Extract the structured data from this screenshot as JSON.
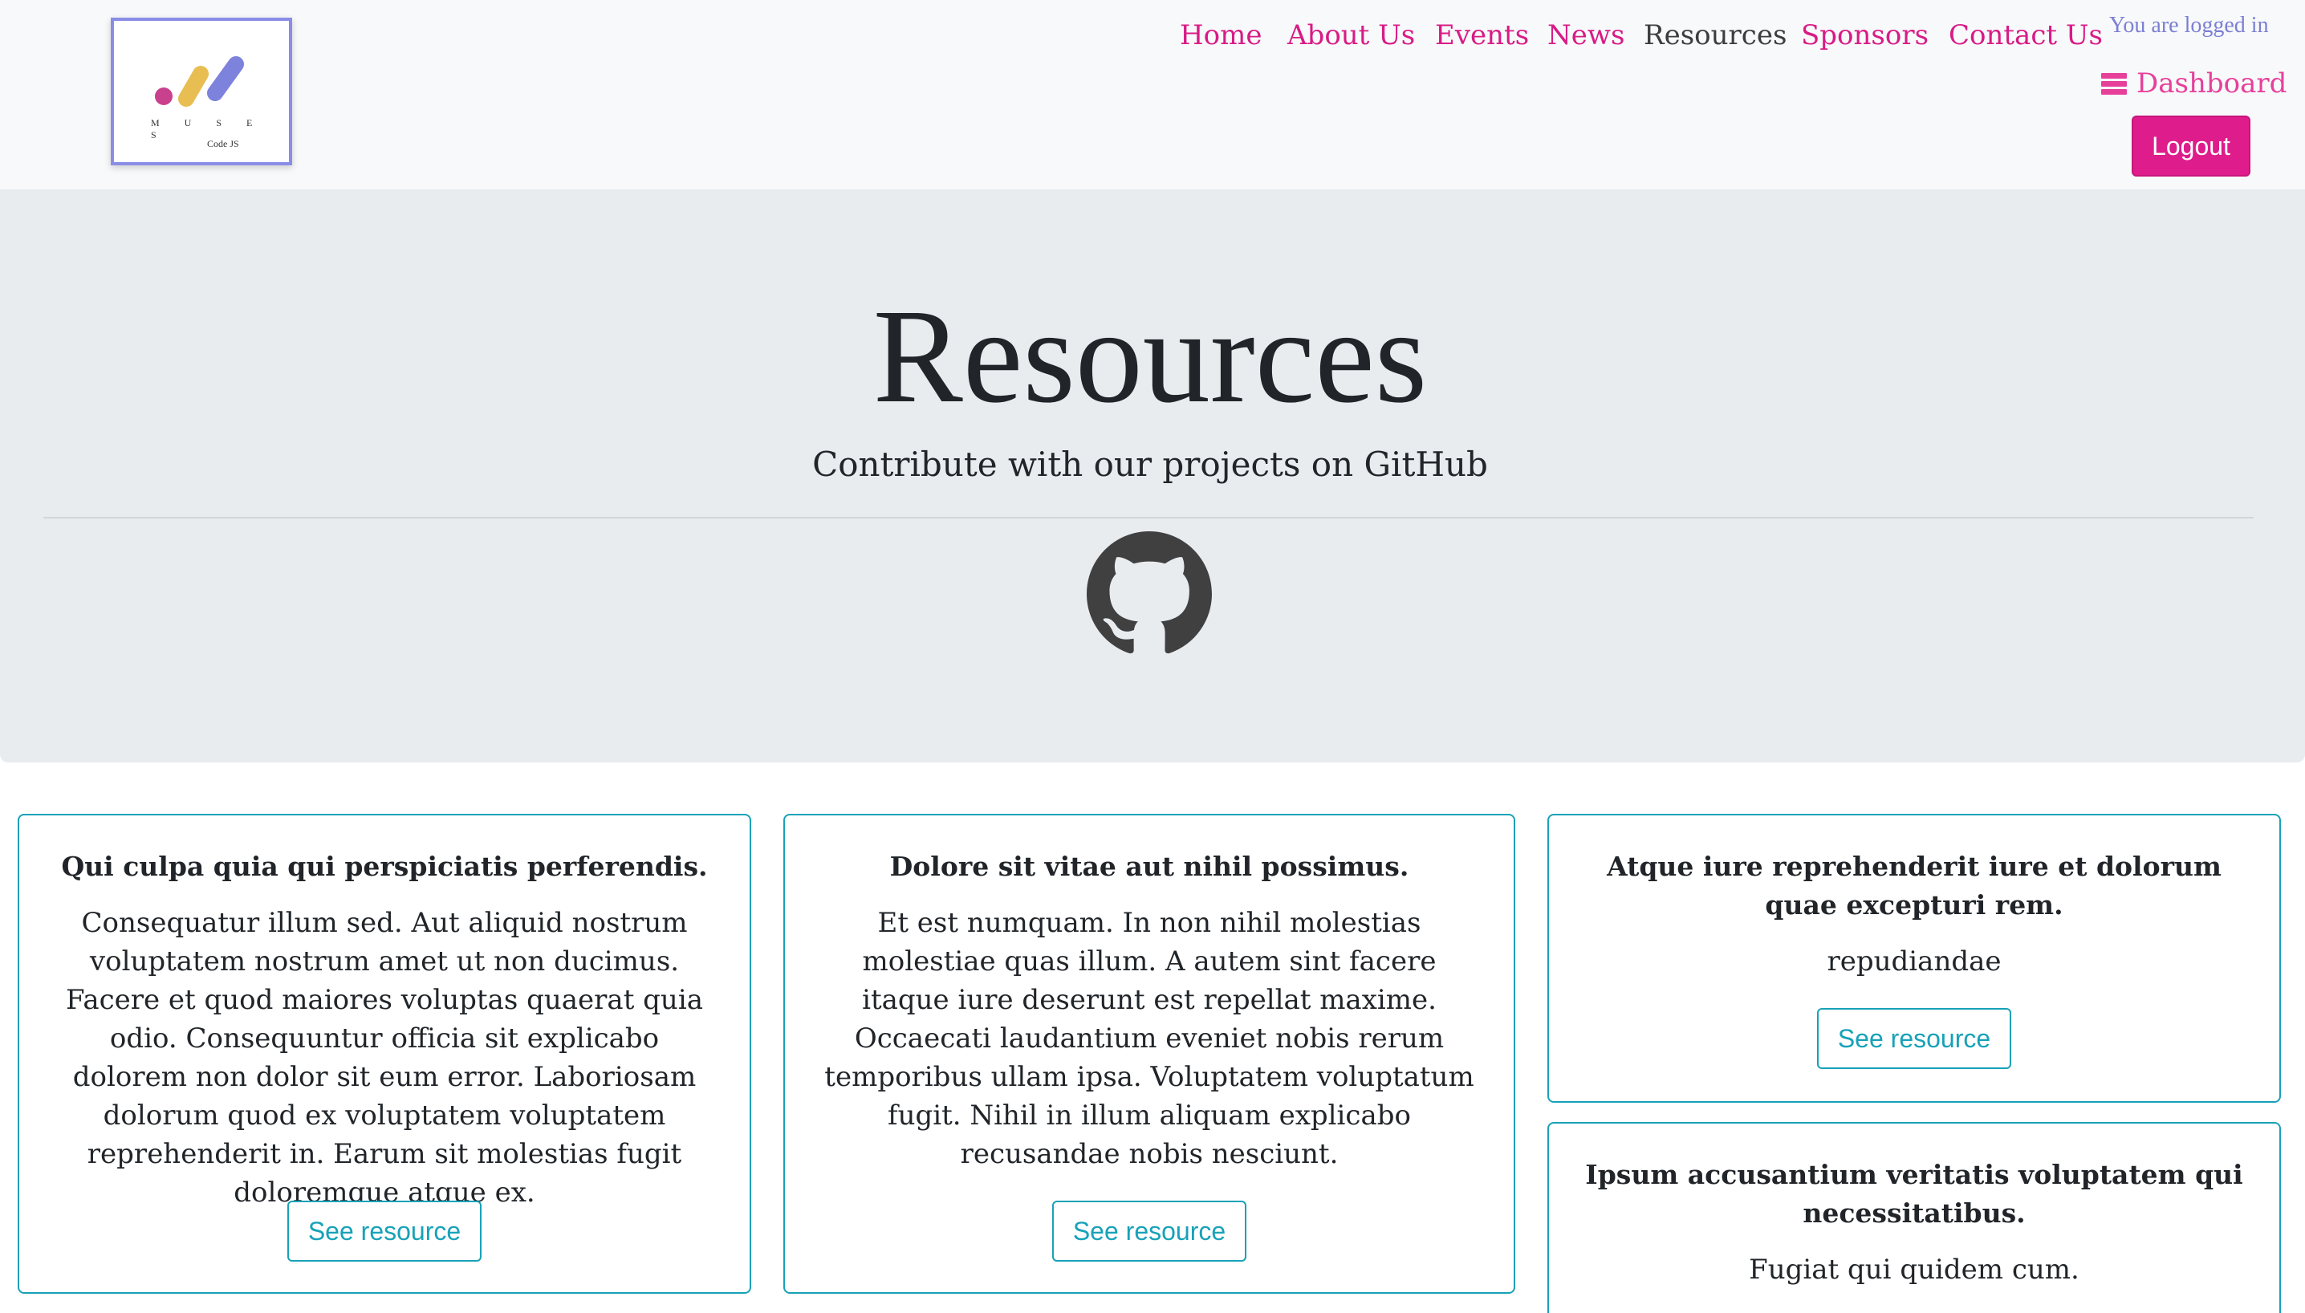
{
  "nav": {
    "logo": {
      "word": "M U S E S",
      "sub": "Code JS"
    },
    "links": [
      {
        "label": "Home",
        "active": false
      },
      {
        "label": "About Us",
        "active": false
      },
      {
        "label": "Events",
        "active": false
      },
      {
        "label": "News",
        "active": false
      },
      {
        "label": "Resources",
        "active": true
      },
      {
        "label": "Sponsors",
        "active": false
      },
      {
        "label": "Contact Us",
        "active": false
      }
    ],
    "logged_in_text": "You are logged in",
    "dashboard_label": "Dashboard",
    "logout_label": "Logout"
  },
  "hero": {
    "title": "Resources",
    "subtitle": "Contribute with our projects on GitHub",
    "icon": "github-icon"
  },
  "cards": [
    {
      "title": "Qui culpa quia qui perspiciatis perferendis.",
      "text": "Consequatur illum sed. Aut aliquid nostrum voluptatem nostrum amet ut non ducimus. Facere et quod maiores voluptas quaerat quia odio. Consequuntur officia sit explicabo dolorem non dolor sit eum error. Laboriosam dolorum quod ex voluptatem voluptatem reprehenderit in. Earum sit molestias fugit doloremque atque ex.",
      "button": "See resource"
    },
    {
      "title": "Dolore sit vitae aut nihil possimus.",
      "text": "Et est numquam. In non nihil molestias molestiae quas illum. A autem sint facere itaque iure deserunt est repellat maxime. Occaecati laudantium eveniet nobis rerum temporibus ullam ipsa. Voluptatem voluptatum fugit. Nihil in illum aliquam explicabo recusandae nobis nesciunt.",
      "button": "See resource"
    },
    {
      "title": "Atque iure reprehenderit iure et dolorum quae excepturi rem.",
      "text": "repudiandae",
      "button": "See resource"
    },
    {
      "title": "Ipsum accusantium veritatis voluptatem qui necessitatibus.",
      "text": "Fugiat qui quidem cum."
    }
  ],
  "colors": {
    "brand_pink": "#d81b86",
    "accent_teal": "#17a2b8",
    "logged_in_purple": "#7b7fd4",
    "hero_bg": "#e9ecef",
    "navbar_bg": "#f8f9fa"
  }
}
